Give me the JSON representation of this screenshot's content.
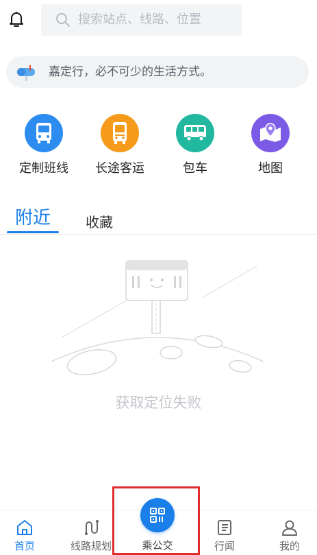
{
  "header": {
    "bell_icon": "bell-icon",
    "search": {
      "placeholder": "搜索站点、线路、位置",
      "icon": "search-icon"
    }
  },
  "notice": {
    "icon": "mailbox-icon",
    "text": "嘉定行，必不可少的生活方式。"
  },
  "services": [
    {
      "label": "定制班线",
      "icon": "bus-icon",
      "color": "#2d8cf0"
    },
    {
      "label": "长途客运",
      "icon": "coach-icon",
      "color": "#f59a1b"
    },
    {
      "label": "包车",
      "icon": "minibus-icon",
      "color": "#22b8a0"
    },
    {
      "label": "地图",
      "icon": "map-pin-icon",
      "color": "#7b5be6"
    }
  ],
  "tabs": [
    {
      "label": "附近",
      "active": true
    },
    {
      "label": "收藏",
      "active": false
    }
  ],
  "empty_state": {
    "icon": "bus-stop-moon-illustration",
    "text": "获取定位失败"
  },
  "bottom_nav": [
    {
      "label": "首页",
      "icon": "home-icon",
      "active": true
    },
    {
      "label": "线路规划",
      "icon": "route-icon",
      "active": false
    },
    {
      "label": "乘公交",
      "icon": "qr-code-icon",
      "active": false
    },
    {
      "label": "行闻",
      "icon": "news-icon",
      "active": false
    },
    {
      "label": "我的",
      "icon": "user-icon",
      "active": false
    }
  ],
  "colors": {
    "accent": "#1a7fe8",
    "highlight": "#e02c2c"
  }
}
